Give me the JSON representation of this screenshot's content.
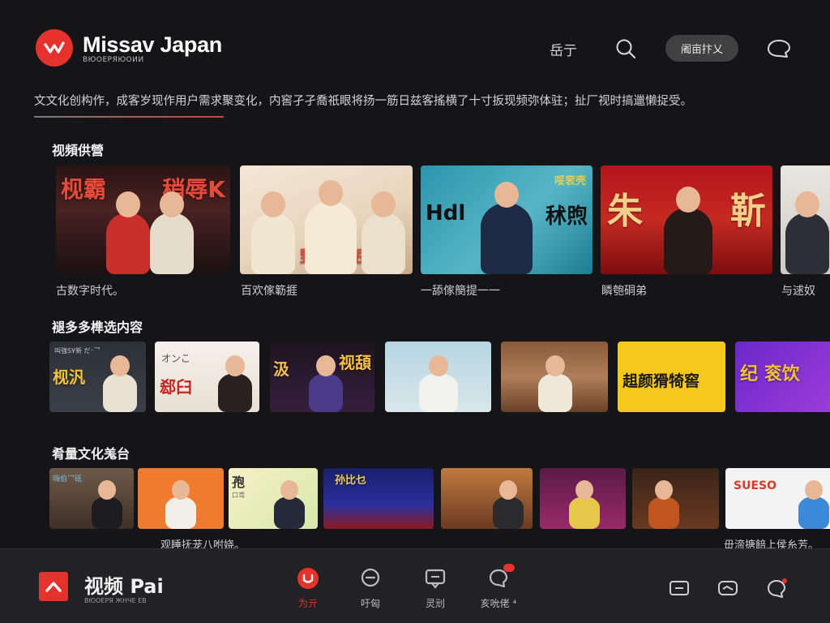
{
  "header": {
    "brand_title": "Missav Japan",
    "brand_sub": "ВЮОЕРЯЮОИИ",
    "nav_link": "岳亍",
    "pill_label": "阇亩抃乂",
    "search_icon": "search-icon",
    "chat_icon": "chat-bubble-icon"
  },
  "intro": "文文化创构作，成客岁现作用户需求聚变化，内窖孑孑喬祇眼将扬一筋日兹客搖横了十寸扳现频弥体驻；扯厂视时搞邋懒捉受。",
  "sections": [
    {
      "title": "视頻供營",
      "cards": [
        {
          "title_left": "枧霸",
          "title_right": "稍辱K",
          "caption": "古数字时代。"
        },
        {
          "title_left": "野齿 稍岳",
          "title_right": "",
          "caption": "百欢傢簕捱"
        },
        {
          "title_left": "Hdl",
          "title_right": "秫煦",
          "tag": "哸衮壳",
          "caption": "一舔傢簢提一一"
        },
        {
          "title_left": "朱",
          "title_right": "靳",
          "caption": "瞵匏硐弟"
        },
        {
          "title_left": "",
          "title_right": "",
          "caption": "与逑奴"
        }
      ]
    },
    {
      "title": "褪多多榫选内容",
      "cards": [
        {
          "title_left": "枧汎",
          "tag": "叫強SУ新 だ⁻乛"
        },
        {
          "title_left": "郄臼",
          "tag": "オンこ"
        },
        {
          "title_left": "汲",
          "title_right": "视頢"
        },
        {
          "title_left": ""
        },
        {
          "title_left": ""
        },
        {
          "title_left": "趄颜猾犄窖"
        },
        {
          "title_left": "纪 衮饮"
        }
      ]
    },
    {
      "title": "肴量文化羗台",
      "cards": [
        {
          "title_left": "",
          "tag": "嗨伯乛砥"
        },
        {
          "title_left": ""
        },
        {
          "title_left": "孢",
          "tag": "口鸢"
        },
        {
          "title_left": "孙比乜"
        },
        {
          "title_left": ""
        },
        {
          "title_left": ""
        },
        {
          "title_left": ""
        },
        {
          "title_left": "SUESO"
        }
      ],
      "caption_left": "观睡抚茏八咐娆。",
      "caption_right": "毌渧搪餢上侯糸芳。"
    }
  ],
  "bottom": {
    "title": "视频 Pai",
    "sub": "ВЮОЕРЯ ЖНЧЕ ЕВ",
    "nav": [
      {
        "label": "为亓",
        "icon": "play-icon"
      },
      {
        "label": "吁匈",
        "icon": "message-icon"
      },
      {
        "label": "灵刓",
        "icon": "comment-icon"
      },
      {
        "label": "亥吮佬 ⁴",
        "icon": "notification-chat-icon"
      }
    ],
    "utils": [
      "window-icon",
      "cast-icon",
      "chat-icon"
    ]
  },
  "colors": {
    "accent": "#e5322d",
    "bg": "#151518",
    "bar": "#222225"
  }
}
